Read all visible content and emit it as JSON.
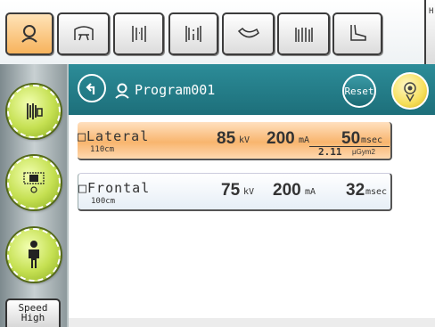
{
  "toolbar": {
    "buttons": [
      {
        "icon": "patient-icon",
        "active": true
      },
      {
        "icon": "head-icon"
      },
      {
        "icon": "spine-icon"
      },
      {
        "icon": "chest-icon"
      },
      {
        "icon": "arm-icon"
      },
      {
        "icon": "hands-icon"
      },
      {
        "icon": "foot-icon"
      }
    ],
    "edge_letter": "H"
  },
  "left_panel": {
    "buttons": [
      {
        "icon": "detector-icon"
      },
      {
        "icon": "exposure-field-icon"
      },
      {
        "icon": "standing-patient-icon"
      }
    ],
    "speed_label": "Speed",
    "speed_value": "High"
  },
  "header": {
    "program_name": "Program001",
    "reset_label": "Reset"
  },
  "programs": [
    {
      "name": "□Lateral",
      "distance": "110cm",
      "kv": "85",
      "kv_unit": "kV",
      "ma": "200",
      "ma_unit": "mA",
      "msec": "50",
      "msec_unit": "msec",
      "dose": "2.11",
      "dose_unit": "µGym2",
      "selected": true
    },
    {
      "name": "□Frontal",
      "distance": "100cm",
      "kv": "75",
      "kv_unit": "kV",
      "ma": "200",
      "ma_unit": "mA",
      "msec": "32",
      "msec_unit": "msec",
      "selected": false
    }
  ],
  "colors": {
    "header_teal": "#1d6f7a",
    "selected_orange": "#f8b56e",
    "green_button": "#c5e052",
    "emit_yellow": "#f6df5a"
  }
}
